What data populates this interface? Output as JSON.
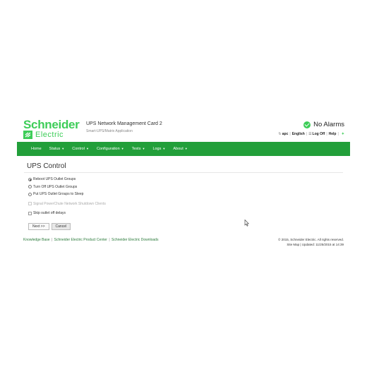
{
  "header": {
    "logo_top": "Schneider",
    "logo_bottom": "Electric",
    "app_title": "UPS Network Management Card 2",
    "app_subtitle": "Smart-UPS/Matrix Application",
    "alarm_text": "No Alarms",
    "utility": {
      "apc": "apc",
      "language": "English",
      "log_off": "Log Off",
      "help": "Help"
    }
  },
  "nav": {
    "items": [
      {
        "label": "Home",
        "caret": false
      },
      {
        "label": "Status",
        "caret": true
      },
      {
        "label": "Control",
        "caret": true
      },
      {
        "label": "Configuration",
        "caret": true
      },
      {
        "label": "Tests",
        "caret": true
      },
      {
        "label": "Logs",
        "caret": true
      },
      {
        "label": "About",
        "caret": true
      }
    ]
  },
  "page": {
    "title": "UPS Control",
    "options": [
      {
        "label": "Reboot UPS Outlet Groups",
        "checked": true
      },
      {
        "label": "Turn Off UPS Outlet Groups",
        "checked": false
      },
      {
        "label": "Put UPS Outlet Groups to Sleep",
        "checked": false
      }
    ],
    "checkboxes": [
      {
        "label": "Signal PowerChute Network Shutdown Clients",
        "disabled": true
      },
      {
        "label": "Skip outlet off delays",
        "disabled": false
      }
    ],
    "next_label": "Next >>",
    "cancel_label": "Cancel"
  },
  "footer": {
    "links": [
      "Knowledge Base",
      "Schneider Electric Product Center",
      "Schneider Electric Downloads"
    ],
    "copyright": "© 2015, Schneider Electric. All rights reserved.",
    "site_map": "Site Map",
    "updated": "Updated: 11/25/2015 at 14:39"
  },
  "colors": {
    "brand_green": "#3dcd58",
    "nav_green": "#229f3a"
  }
}
